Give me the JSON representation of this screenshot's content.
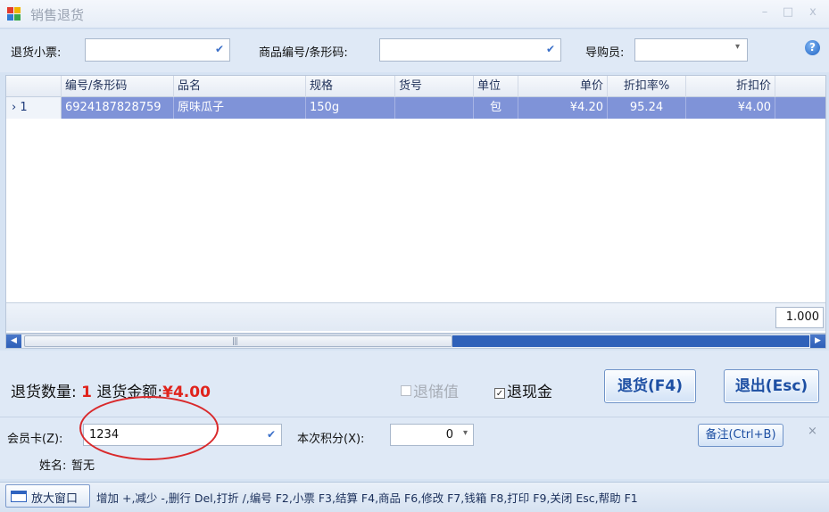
{
  "window": {
    "title": "销售退货",
    "controls": [
      "–",
      "□",
      "x"
    ]
  },
  "filters": {
    "receipt_label": "退货小票:",
    "receipt_value": "",
    "product_label": "商品编号/条形码:",
    "product_value": "",
    "guide_label": "导购员:",
    "guide_value": ""
  },
  "grid": {
    "columns": [
      "编号/条形码",
      "品名",
      "规格",
      "货号",
      "单位",
      "单价",
      "折扣率%",
      "折扣价"
    ],
    "rows": [
      {
        "indicator": "› 1",
        "barcode": "6924187828759",
        "name": "原味瓜子",
        "spec": "150g",
        "item_no": "",
        "unit": "包",
        "unit_price": "¥4.20",
        "discount_rate": "95.24",
        "discount_price": "¥4.00"
      }
    ],
    "footer_total": "1.000"
  },
  "summary": {
    "qty_label": "退货数量:",
    "qty_value": "1",
    "amount_label": "退货金额:",
    "amount_value": "¥4.00",
    "stored_value_label": "退储值",
    "cash_label": "退现金",
    "cash_checked": "☑",
    "stored_checked": "☐",
    "return_button": "退货(F4)",
    "exit_button": "退出(Esc)"
  },
  "member": {
    "card_label": "会员卡(Z):",
    "card_value": "1234",
    "points_label": "本次积分(X):",
    "points_value": "0",
    "name_label": "姓名:",
    "name_value": "暂无",
    "memo_button": "备注(Ctrl+B)",
    "close": "×"
  },
  "statusbar": {
    "zoom_button": "放大窗口",
    "hotkeys": "增加 +,减少 -,删行 Del,打折 /,编号 F2,小票 F3,结算 F4,商品 F6,修改 F7,钱箱 F8,打印 F9,关闭 Esc,帮助 F1"
  },
  "colors": {
    "selected_row": "#7f93d8",
    "accent_red": "#e0231c",
    "annotation_circle": "#d9292b"
  }
}
